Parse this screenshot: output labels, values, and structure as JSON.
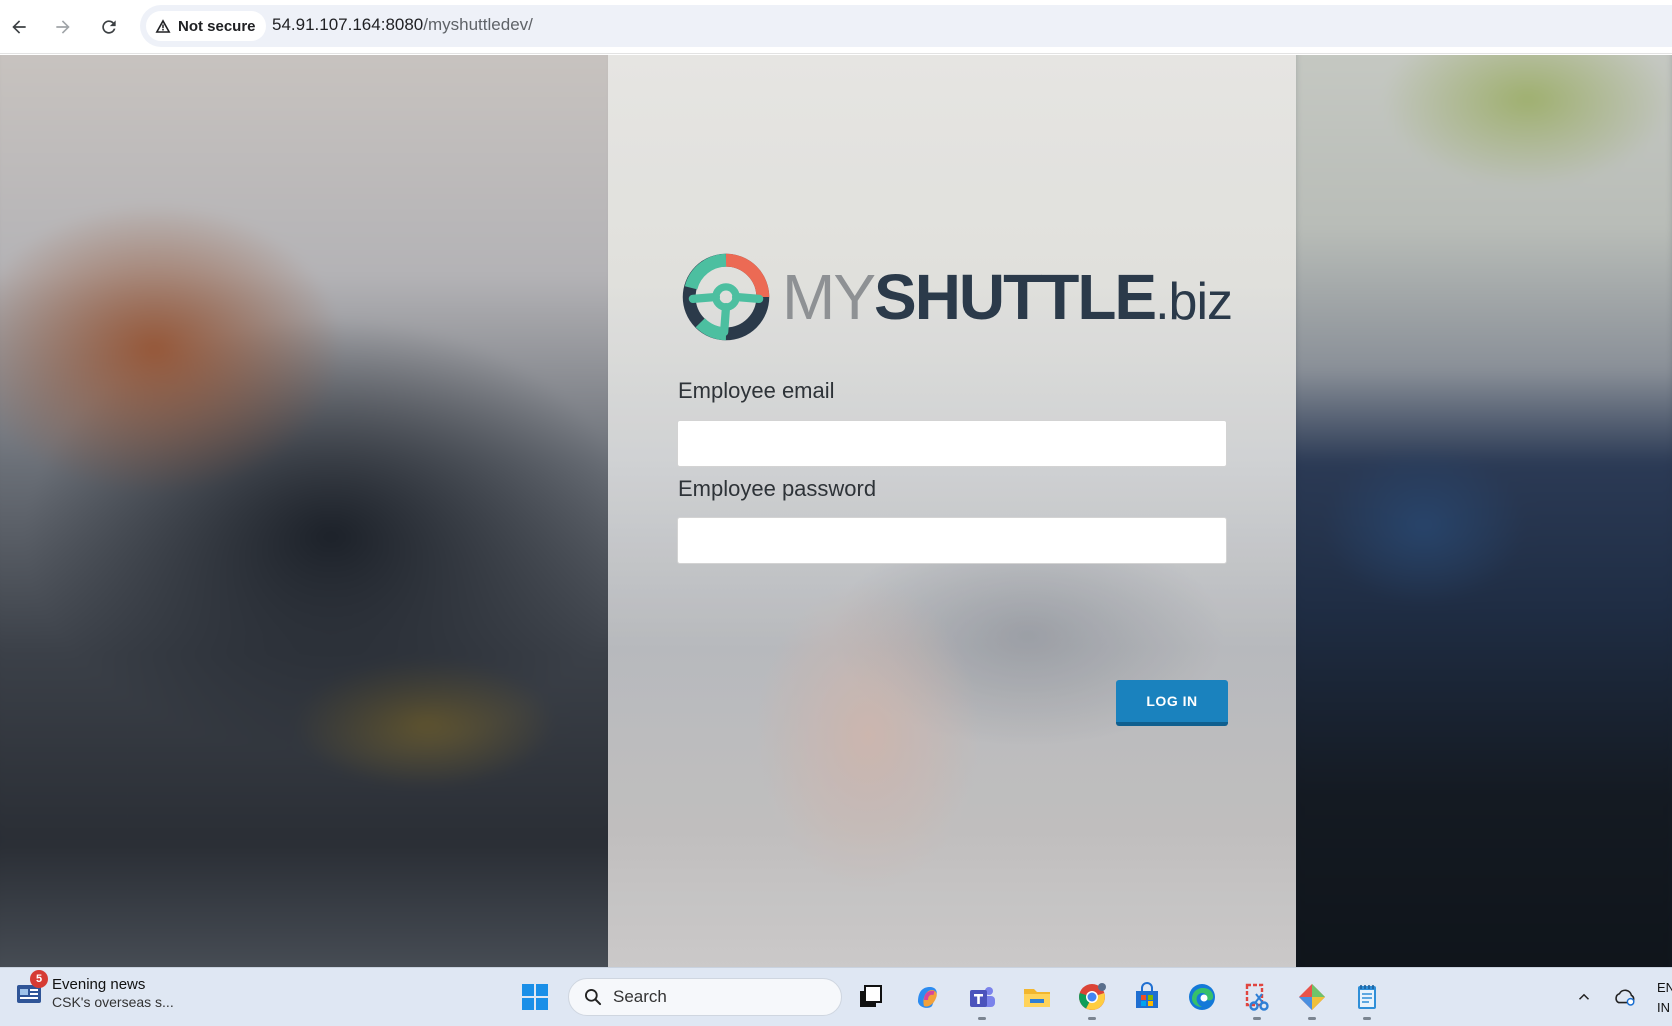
{
  "browser": {
    "security_label": "Not secure",
    "url_host": "54.91.107.164:8080",
    "url_path": "/myshuttledev/"
  },
  "logo": {
    "part_my": "MY",
    "part_shuttle": "SHUTTLE",
    "part_biz": ".biz",
    "colors": {
      "teal": "#4cbfa0",
      "coral": "#ec6a54",
      "navy": "#2b3a4a",
      "gray": "#8e9194"
    }
  },
  "login": {
    "email_label": "Employee email",
    "email_value": "",
    "password_label": "Employee password",
    "password_value": "",
    "button_label": "LOG IN",
    "accent": "#1a82be"
  },
  "taskbar": {
    "news_badge": "5",
    "news_title": "Evening news",
    "news_subtitle": "CSK's overseas s...",
    "search_placeholder": "Search",
    "apps": [
      "windows-start-icon",
      "task-view-icon",
      "copilot-icon",
      "teams-icon",
      "file-explorer-icon",
      "chrome-icon",
      "store-icon",
      "edge-icon",
      "snipping-tool-icon",
      "git-icon",
      "notepad-icon"
    ],
    "tray_lang": "EN",
    "tray_region": "IN"
  }
}
